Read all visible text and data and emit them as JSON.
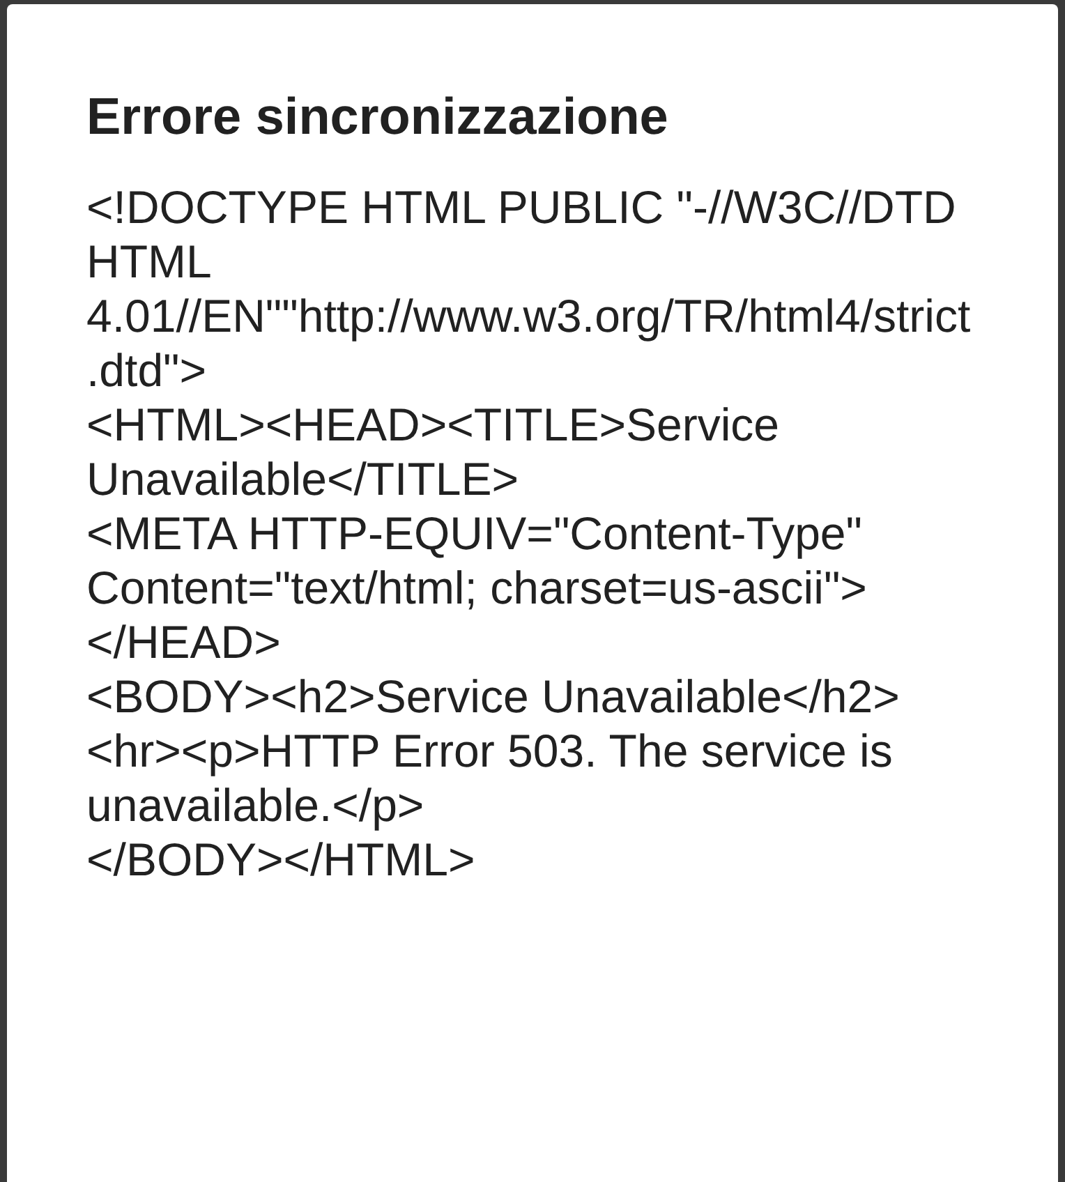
{
  "dialog": {
    "title": "Errore sincronizzazione",
    "message": "<!DOCTYPE HTML PUBLIC \"-//W3C//DTD HTML 4.01//EN\"\"http://www.w3.org/TR/html4/strict.dtd\">\n<HTML><HEAD><TITLE>Service Unavailable</TITLE>\n<META HTTP-EQUIV=\"Content-Type\" Content=\"text/html; charset=us-ascii\"></HEAD>\n<BODY><h2>Service Unavailable</h2>\n<hr><p>HTTP Error 503. The service is unavailable.</p>\n</BODY></HTML>"
  }
}
